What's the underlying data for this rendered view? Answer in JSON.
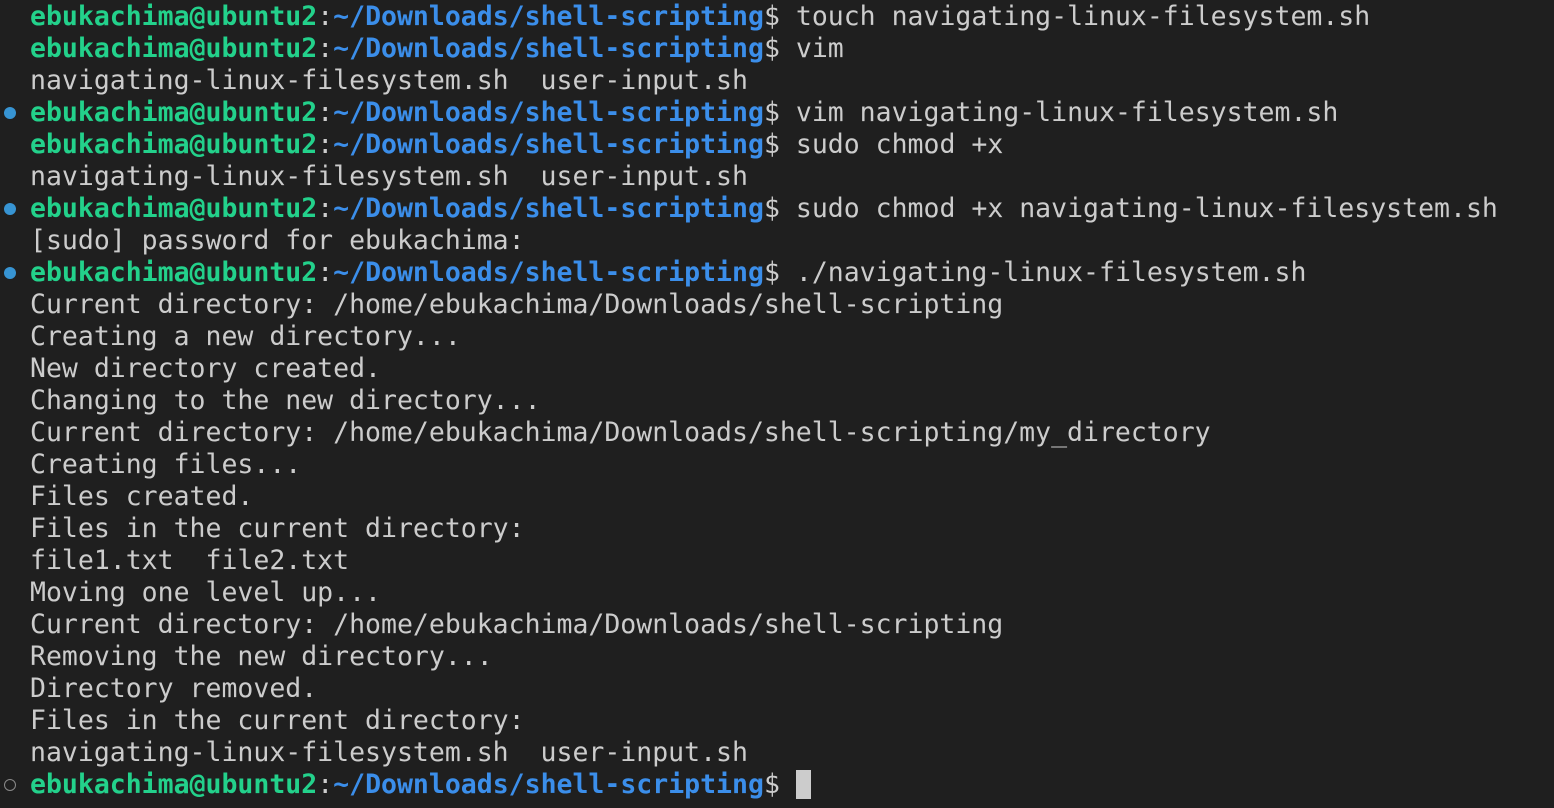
{
  "terminal": {
    "prompt": {
      "user_host": "ebukachima@ubuntu2",
      "separator": ":",
      "path": "~/Downloads/shell-scripting",
      "symbol": "$"
    },
    "colors": {
      "background": "#1f1f1f",
      "foreground": "#cccccc",
      "user_host": "#23d18b",
      "path": "#3b8eea",
      "decoration_success": "#3794d3",
      "decoration_pending": "#8a8a8a"
    },
    "lines": [
      {
        "type": "prompt",
        "decoration": "none",
        "command": " touch navigating-linux-filesystem.sh"
      },
      {
        "type": "prompt",
        "decoration": "none",
        "command": " vim"
      },
      {
        "type": "output",
        "text": "navigating-linux-filesystem.sh  user-input.sh"
      },
      {
        "type": "prompt",
        "decoration": "success",
        "command": " vim navigating-linux-filesystem.sh"
      },
      {
        "type": "prompt",
        "decoration": "none",
        "command": " sudo chmod +x"
      },
      {
        "type": "output",
        "text": "navigating-linux-filesystem.sh  user-input.sh"
      },
      {
        "type": "prompt",
        "decoration": "success",
        "command": " sudo chmod +x navigating-linux-filesystem.sh"
      },
      {
        "type": "output",
        "text": "[sudo] password for ebukachima:"
      },
      {
        "type": "prompt",
        "decoration": "success",
        "command": " ./navigating-linux-filesystem.sh"
      },
      {
        "type": "output",
        "text": "Current directory: /home/ebukachima/Downloads/shell-scripting"
      },
      {
        "type": "output",
        "text": "Creating a new directory..."
      },
      {
        "type": "output",
        "text": "New directory created."
      },
      {
        "type": "output",
        "text": "Changing to the new directory..."
      },
      {
        "type": "output",
        "text": "Current directory: /home/ebukachima/Downloads/shell-scripting/my_directory"
      },
      {
        "type": "output",
        "text": "Creating files..."
      },
      {
        "type": "output",
        "text": "Files created."
      },
      {
        "type": "output",
        "text": "Files in the current directory:"
      },
      {
        "type": "output",
        "text": "file1.txt  file2.txt"
      },
      {
        "type": "output",
        "text": "Moving one level up..."
      },
      {
        "type": "output",
        "text": "Current directory: /home/ebukachima/Downloads/shell-scripting"
      },
      {
        "type": "output",
        "text": "Removing the new directory..."
      },
      {
        "type": "output",
        "text": "Directory removed."
      },
      {
        "type": "output",
        "text": "Files in the current directory:"
      },
      {
        "type": "output",
        "text": "navigating-linux-filesystem.sh  user-input.sh"
      },
      {
        "type": "prompt",
        "decoration": "pending",
        "command": "",
        "cursor": true
      }
    ]
  }
}
